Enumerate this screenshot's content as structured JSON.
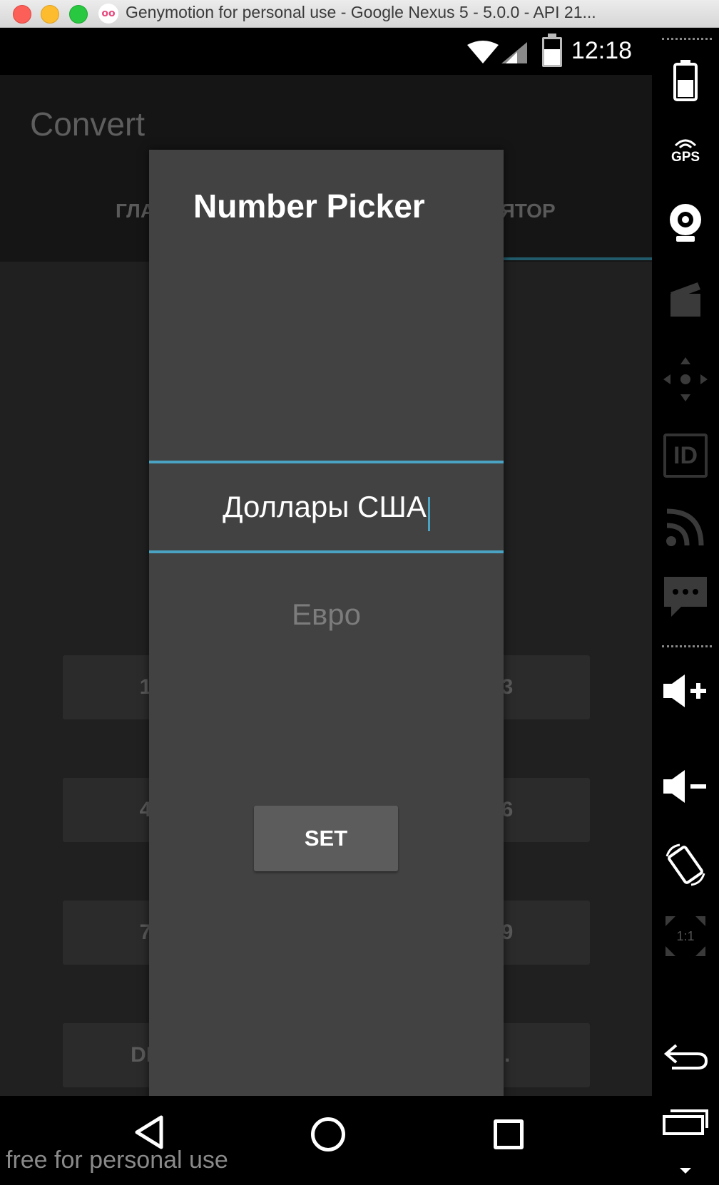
{
  "window": {
    "title": "Genymotion for personal use - Google Nexus 5 - 5.0.0 - API 21..."
  },
  "status_bar": {
    "time": "12:18"
  },
  "app": {
    "title": "Convert",
    "tabs": [
      "ГЛА",
      "ЛЯТОР"
    ],
    "keys": [
      "1",
      "3",
      "4",
      "6",
      "7",
      "9",
      "DE",
      "."
    ]
  },
  "dialog": {
    "title": "Number Picker",
    "picker_selected": "Доллары США",
    "picker_next": "Евро",
    "set_label": "SET"
  },
  "nav": {
    "watermark": "free for personal use"
  },
  "toolbar": {
    "gps_label": "GPS",
    "id_label": "ID",
    "ratio_label": "1:1"
  },
  "colors": {
    "accent": "#4aa3c2",
    "dialog_bg": "#424242"
  }
}
